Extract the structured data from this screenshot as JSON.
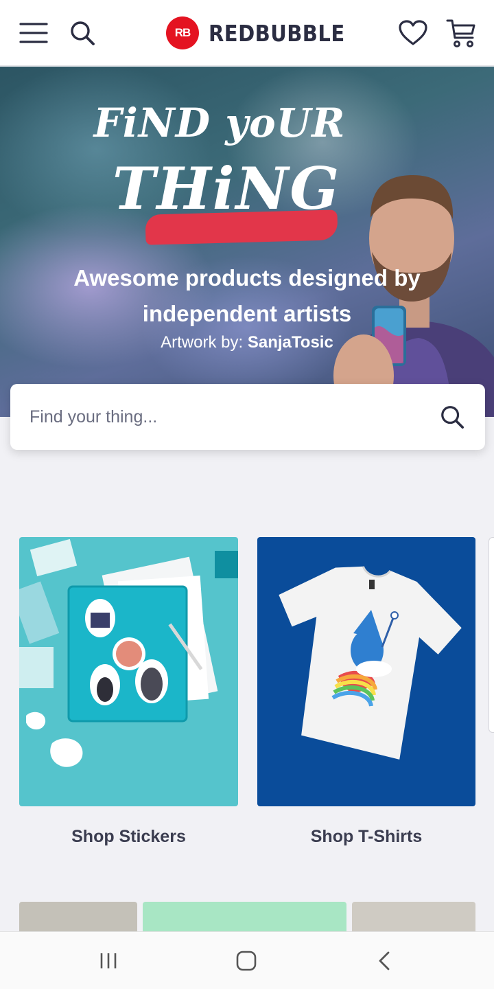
{
  "header": {
    "logo_mark": "RB",
    "logo_text": "REDBUBBLE",
    "icons": {
      "menu": "hamburger-icon",
      "search": "search-icon",
      "wishlist": "heart-icon",
      "cart": "cart-icon"
    }
  },
  "hero": {
    "title_line1": "FiND yoUR",
    "title_line2": "THiNG",
    "subtitle": "Awesome products designed by independent artists",
    "credit_prefix": "Artwork by:",
    "credit_artist": "SanjaTosic",
    "accent_color": "#e2364a"
  },
  "search": {
    "placeholder": "Find your thing..."
  },
  "cards": [
    {
      "label": "Shop Stickers"
    },
    {
      "label": "Shop T-Shirts"
    }
  ],
  "brand_color": "#e41321",
  "navbar": {
    "icons": [
      "recent-apps-icon",
      "home-icon",
      "back-icon"
    ]
  }
}
